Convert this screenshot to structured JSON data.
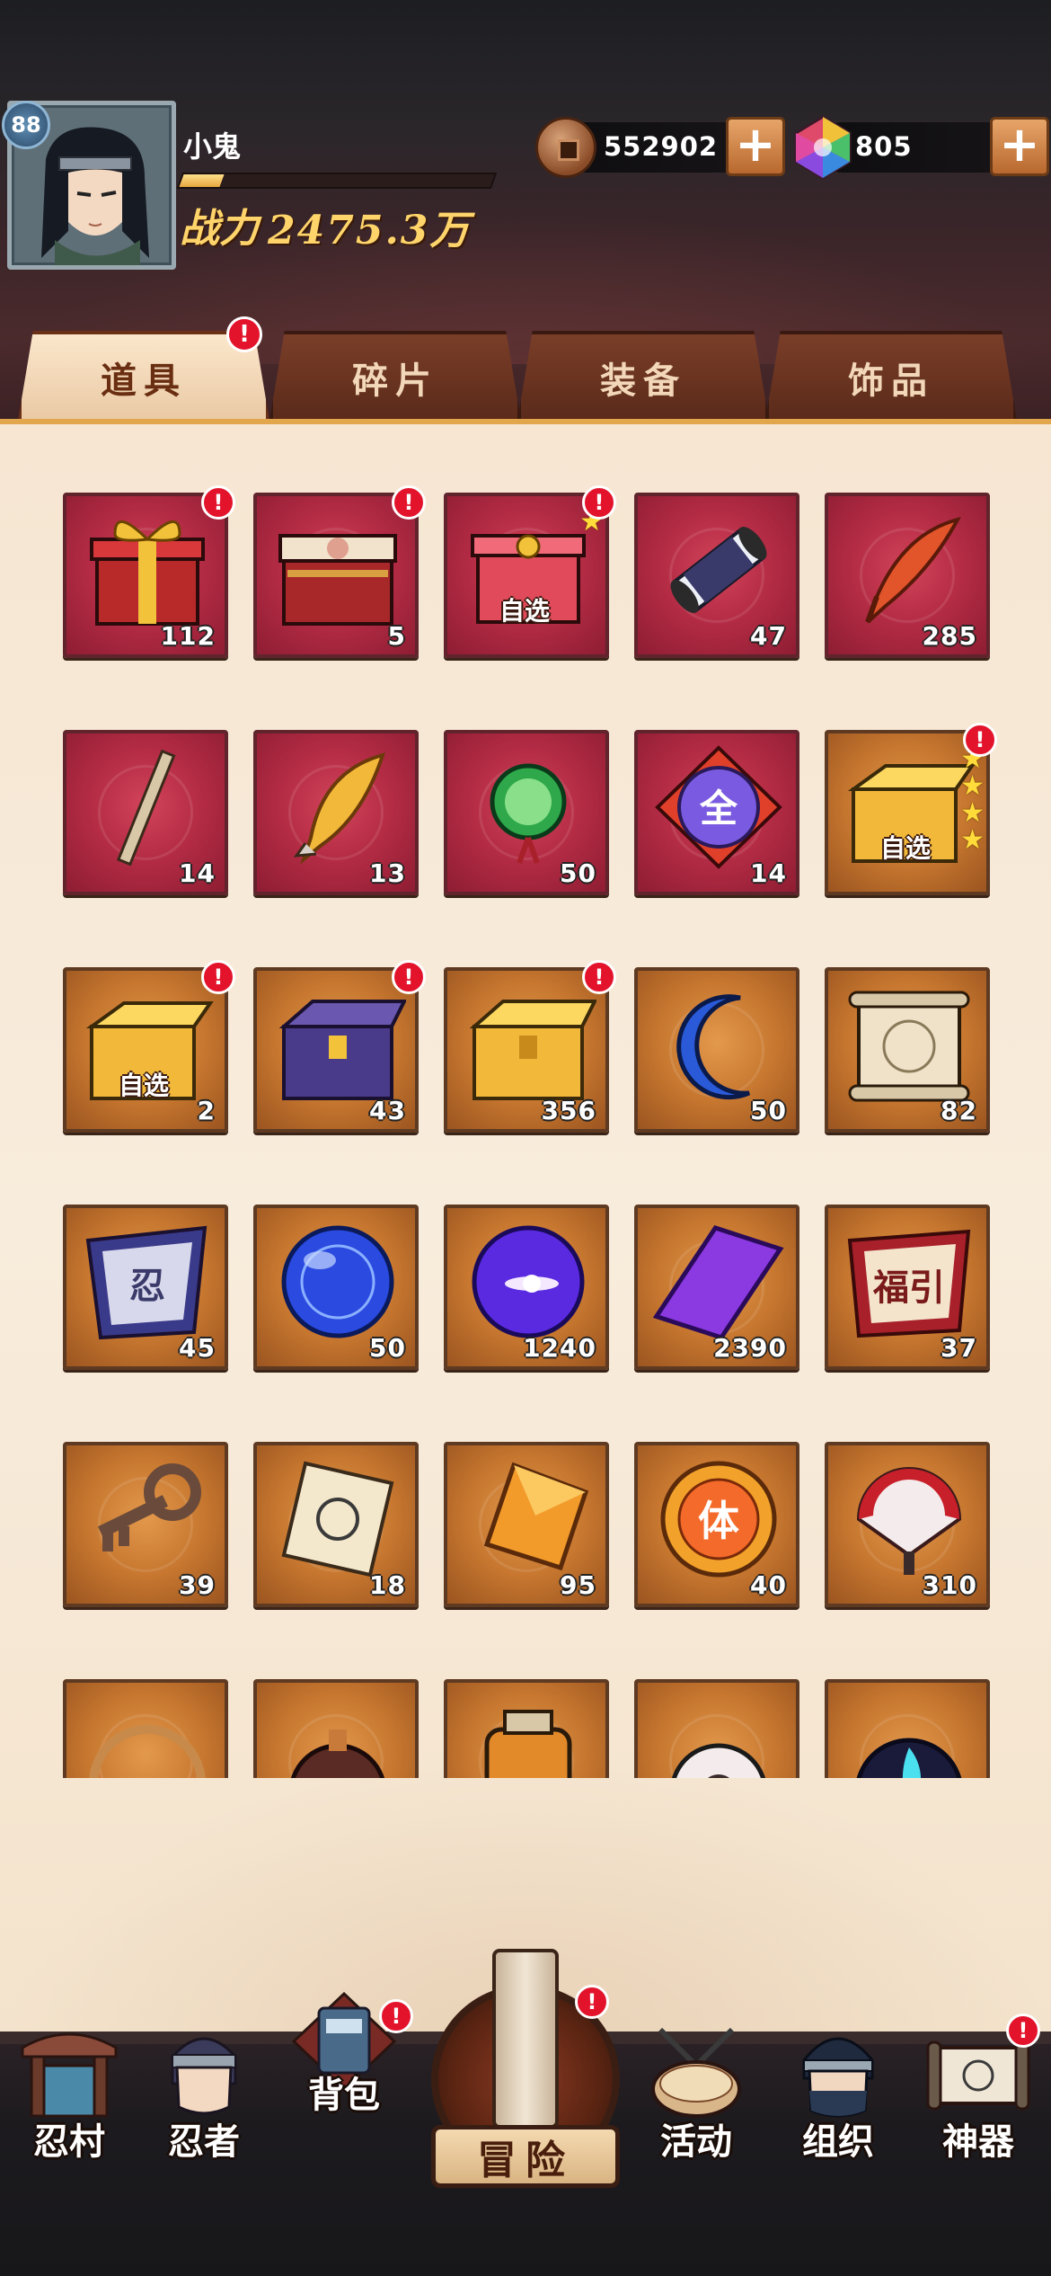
{
  "player": {
    "level": "88",
    "name": "小鬼",
    "exp_fraction": 0.13,
    "power_label": "战力",
    "power_value": "2475.3万"
  },
  "currencies": {
    "coins": "552902",
    "gems": "805",
    "plus_label": "+"
  },
  "tabs": [
    {
      "label": "道具",
      "active": true,
      "badge": "!"
    },
    {
      "label": "碎片",
      "active": false
    },
    {
      "label": "装备",
      "active": false
    },
    {
      "label": "饰品",
      "active": false
    }
  ],
  "items": [
    {
      "icon": "gift-box-icon",
      "bg": "red",
      "count": "112",
      "badge": "!"
    },
    {
      "icon": "treasure-chest-icon",
      "bg": "red",
      "count": "5",
      "badge": "!"
    },
    {
      "icon": "selectable-gift-box-icon",
      "bg": "red",
      "count": "",
      "badge": "!",
      "pick": "自选",
      "stars": 1
    },
    {
      "icon": "scroll-icon",
      "bg": "red",
      "count": "47"
    },
    {
      "icon": "red-feather-icon",
      "bg": "red",
      "count": "285"
    },
    {
      "icon": "stick-icon",
      "bg": "red",
      "count": "14"
    },
    {
      "icon": "gold-feather-icon",
      "bg": "red",
      "count": "13"
    },
    {
      "icon": "jade-pendant-icon",
      "bg": "red",
      "count": "50"
    },
    {
      "icon": "all-orb-icon",
      "bg": "red",
      "count": "14"
    },
    {
      "icon": "selectable-gold-box-icon",
      "bg": "orange",
      "count": "",
      "badge": "!",
      "pick": "自选",
      "stars": 4
    },
    {
      "icon": "selectable-gold-box-icon",
      "bg": "orange",
      "count": "2",
      "badge": "!",
      "pick": "自选"
    },
    {
      "icon": "purple-chest-icon",
      "bg": "orange",
      "count": "43",
      "badge": "!"
    },
    {
      "icon": "gold-chest-icon",
      "bg": "orange",
      "count": "356",
      "badge": "!"
    },
    {
      "icon": "blue-crescent-icon",
      "bg": "orange",
      "count": "50"
    },
    {
      "icon": "map-scroll-icon",
      "bg": "orange",
      "count": "82"
    },
    {
      "icon": "purple-banner-icon",
      "bg": "orange",
      "count": "45"
    },
    {
      "icon": "blue-orb-icon",
      "bg": "orange",
      "count": "50"
    },
    {
      "icon": "purple-orb-icon",
      "bg": "orange",
      "count": "1240"
    },
    {
      "icon": "purple-crystal-icon",
      "bg": "orange",
      "count": "2390"
    },
    {
      "icon": "fortune-banner-icon",
      "bg": "orange",
      "count": "37"
    },
    {
      "icon": "key-icon",
      "bg": "orange",
      "count": "39"
    },
    {
      "icon": "seal-paper-icon",
      "bg": "orange",
      "count": "18"
    },
    {
      "icon": "amber-gem-icon",
      "bg": "orange",
      "count": "95"
    },
    {
      "icon": "stamina-medal-icon",
      "bg": "orange",
      "count": "40"
    },
    {
      "icon": "war-fan-icon",
      "bg": "orange",
      "count": "310"
    },
    {
      "icon": "rope-icon",
      "bg": "orange",
      "count": ""
    },
    {
      "icon": "gourd-icon",
      "bg": "orange",
      "count": ""
    },
    {
      "icon": "lantern-jar-icon",
      "bg": "orange",
      "count": ""
    },
    {
      "icon": "shuriken-bag-icon",
      "bg": "orange",
      "count": ""
    },
    {
      "icon": "blue-flame-orb-icon",
      "bg": "orange",
      "count": ""
    }
  ],
  "nav": [
    {
      "label": "忍村",
      "icon": "village-gate-icon"
    },
    {
      "label": "忍者",
      "icon": "ninja-head-icon"
    },
    {
      "label": "背包",
      "icon": "backpack-icon",
      "badge": "!"
    },
    {
      "label": "冒险",
      "icon": "adventure-scroll-icon",
      "badge": "!"
    },
    {
      "label": "活动",
      "icon": "drum-icon"
    },
    {
      "label": "组织",
      "icon": "masked-ninja-icon"
    },
    {
      "label": "神器",
      "icon": "artifact-scroll-icon",
      "badge": "!"
    }
  ]
}
